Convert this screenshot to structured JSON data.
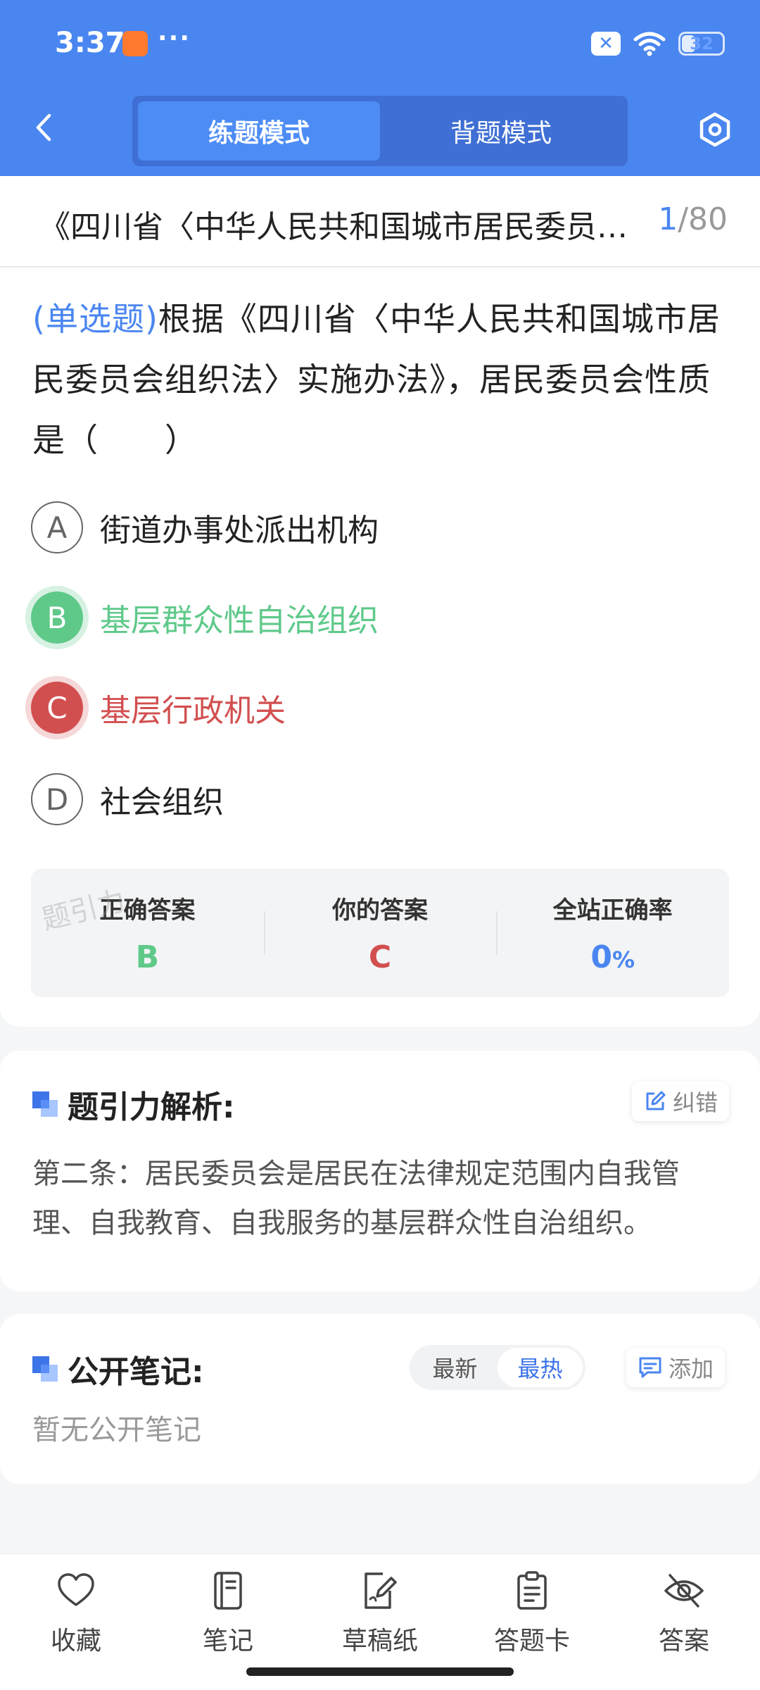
{
  "status_bar": {
    "time": "3:37",
    "dots": "···",
    "x_badge": "✕",
    "battery": "32"
  },
  "header": {
    "modes": [
      {
        "label": "练题模式",
        "active": true
      },
      {
        "label": "背题模式",
        "active": false
      }
    ]
  },
  "question": {
    "title": "《四川省〈中华人民共和国城市居民委员会组织法〉实施办法》",
    "current": "1",
    "total": "/80",
    "type": "(单选题)",
    "text": "根据《四川省〈中华人民共和国城市居民委员会组织法〉实施办法》，居民委员会性质是（　　）",
    "options": [
      {
        "letter": "A",
        "text": "街道办事处派出机构",
        "state": "normal"
      },
      {
        "letter": "B",
        "text": "基层群众性自治组织",
        "state": "correct"
      },
      {
        "letter": "C",
        "text": "基层行政机关",
        "state": "wrong"
      },
      {
        "letter": "D",
        "text": "社会组织",
        "state": "normal"
      }
    ],
    "answer_panel": {
      "correct_label": "正确答案",
      "correct_value": "B",
      "yours_label": "你的答案",
      "yours_value": "C",
      "rate_label": "全站正确率",
      "rate_value": "0",
      "rate_unit": "%"
    },
    "watermark": "题引力"
  },
  "analysis": {
    "title": "题引力解析:",
    "correct_button": "纠错",
    "text": "第二条：居民委员会是居民在法律规定范围内自我管理、自我教育、自我服务的基层群众性自治组织。"
  },
  "notes": {
    "title": "公开笔记:",
    "sort_newest": "最新",
    "sort_hottest": "最热",
    "add_button": "添加",
    "empty": "暂无公开笔记"
  },
  "bottom_nav": [
    {
      "label": "收藏",
      "icon": "heart-icon"
    },
    {
      "label": "笔记",
      "icon": "notebook-icon"
    },
    {
      "label": "草稿纸",
      "icon": "draft-icon"
    },
    {
      "label": "答题卡",
      "icon": "clipboard-icon"
    },
    {
      "label": "答案",
      "icon": "eye-off-icon"
    }
  ],
  "colors": {
    "brand": "#4a86f0",
    "correct": "#5fc98a",
    "wrong": "#d24f4f"
  }
}
